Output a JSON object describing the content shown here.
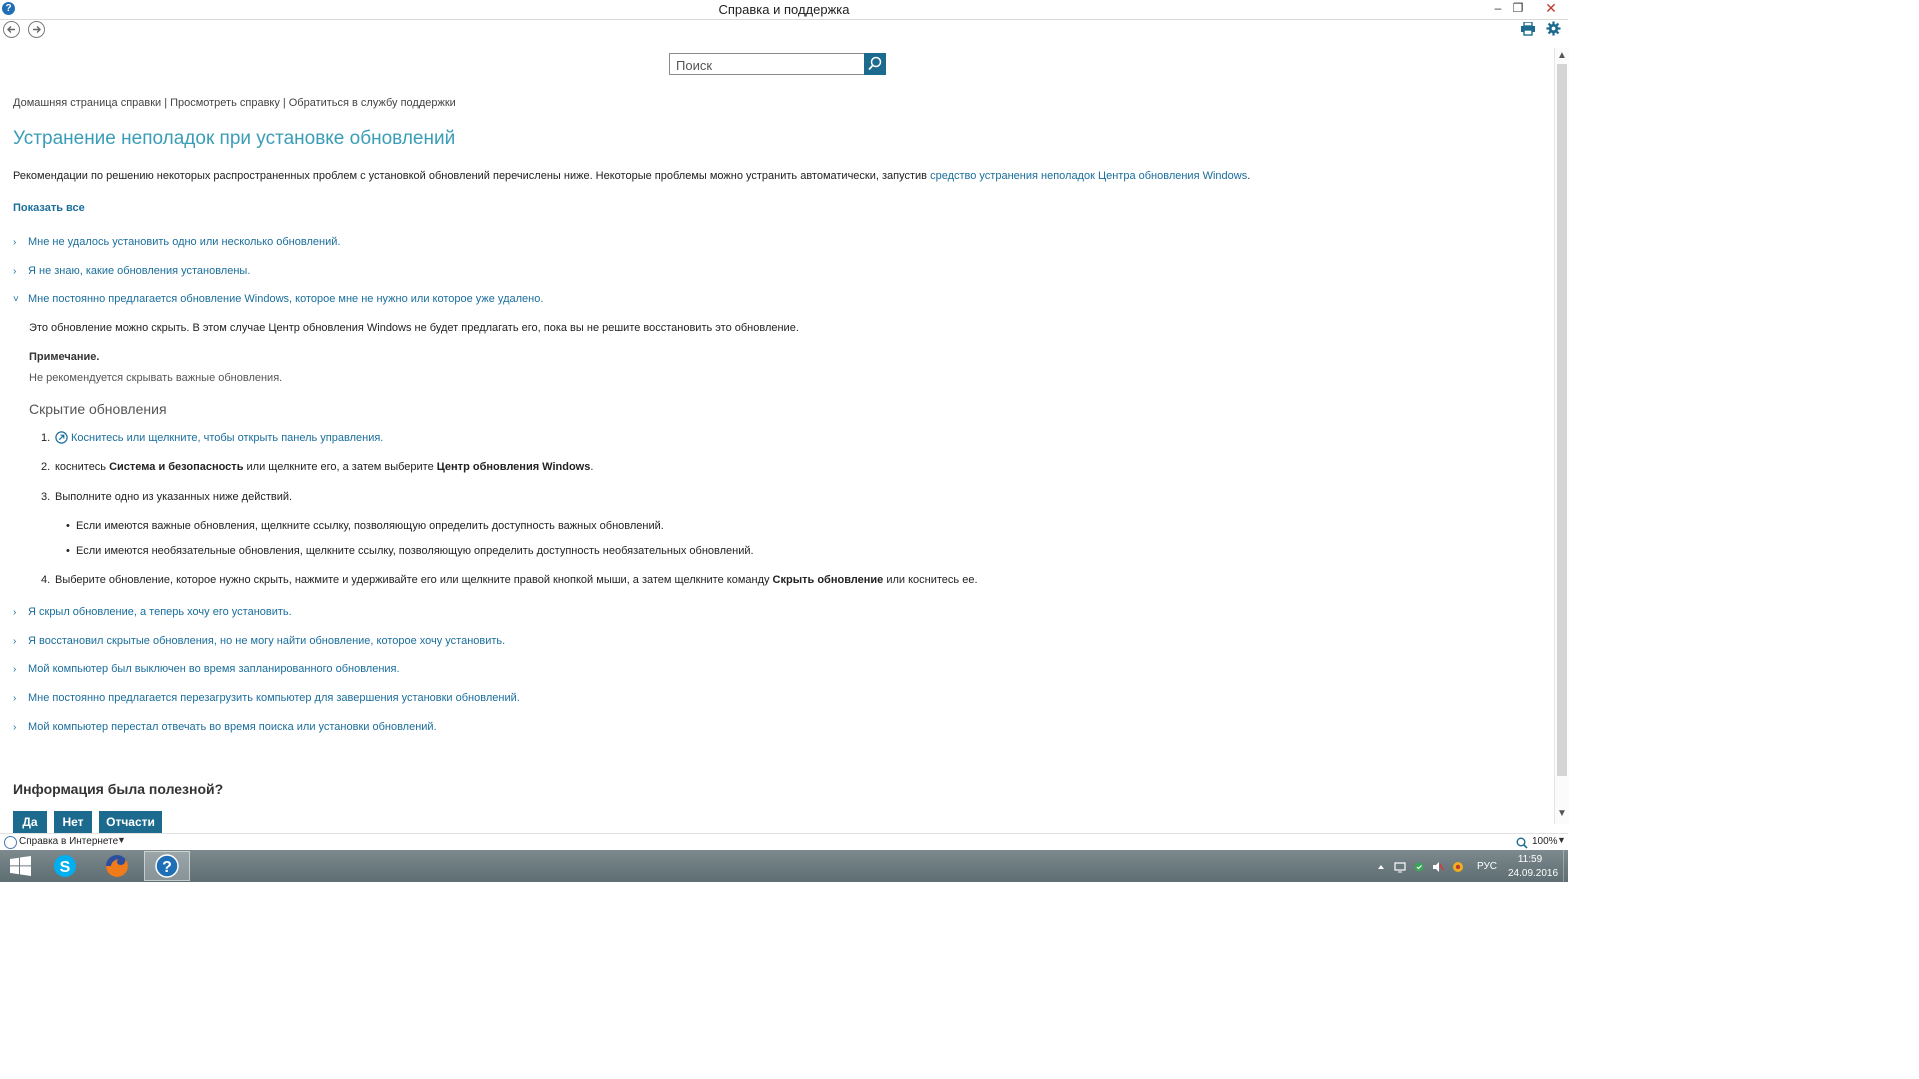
{
  "window": {
    "title": "Справка и поддержка",
    "minimize": "–",
    "restore": "❐",
    "close": "✕"
  },
  "search": {
    "placeholder": "Поиск"
  },
  "breadcrumb": {
    "home": "Домашняя страница справки",
    "browse": "Просмотреть справку",
    "contact": "Обратиться в службу поддержки",
    "separator": "|"
  },
  "page": {
    "title": "Устранение неполадок при установке обновлений",
    "intro": "Рекомендации по решению некоторых распространенных проблем с установкой обновлений перечислены ниже. Некоторые проблемы можно устранить автоматически, запустив ",
    "intro_link": "средство устранения неполадок Центра обновления Windows",
    "intro_end": ".",
    "show_all": "Показать все"
  },
  "questions_top": [
    "Мне не удалось установить одно или несколько обновлений.",
    "Я не знаю, какие обновления установлены.",
    "Мне постоянно предлагается обновление Windows, которое мне не нужно или которое уже удалено."
  ],
  "expanded": {
    "body": "Это обновление можно скрыть. В этом случае Центр обновления Windows не будет предлагать его, пока вы не решите восстановить это обновление.",
    "note_title": "Примечание.",
    "note_text": "Не рекомендуется скрывать важные обновления.",
    "heading": "Скрытие обновления",
    "step1_num": "1.",
    "step1_link": "Коснитесь или щелкните, чтобы открыть панель управления.",
    "step2_num": "2.",
    "step2_a": "коснитесь ",
    "step2_b": "Система и безопасность",
    "step2_c": " или щелкните его, а затем выберите ",
    "step2_d": "Центр обновления Windows",
    "step2_e": ".",
    "step3_num": "3.",
    "step3": "Выполните одно из указанных ниже действий.",
    "bullet1": "Если имеются важные обновления, щелкните ссылку, позволяющую определить доступность важных обновлений.",
    "bullet2": "Если имеются необязательные обновления, щелкните ссылку, позволяющую определить доступность необязательных обновлений.",
    "step4_num": "4.",
    "step4_a": "Выберите обновление, которое нужно скрыть, нажмите и удерживайте его или щелкните правой кнопкой мыши, а затем щелкните команду ",
    "step4_b": "Скрыть обновление",
    "step4_c": " или коснитесь ее."
  },
  "questions_bottom": [
    "Я скрыл обновление, а теперь хочу его установить.",
    "Я восстановил скрытые обновления, но не могу найти обновление, которое хочу установить.",
    "Мой компьютер был выключен во время запланированного обновления.",
    "Мне постоянно предлагается перезагрузить компьютер для завершения установки обновлений.",
    "Мой компьютер перестал отвечать во время поиска или установки обновлений."
  ],
  "feedback": {
    "title": "Информация была полезной?",
    "yes": "Да",
    "no": "Нет",
    "partly": "Отчасти"
  },
  "status": {
    "mode": "Справка в Интернете",
    "zoom": "100%"
  },
  "taskbar": {
    "lang": "РУС",
    "time": "11:59",
    "date": "24.09.2016"
  },
  "icons": {
    "app": "help-icon",
    "back": "back-arrow-icon",
    "forward": "forward-arrow-icon",
    "print": "print-icon",
    "settings": "gear-icon",
    "search": "search-icon"
  },
  "colors": {
    "accent": "#1c6b8e",
    "link": "#1a6e9c",
    "title": "#3a9db8",
    "taskbar": "#6c7b80"
  }
}
